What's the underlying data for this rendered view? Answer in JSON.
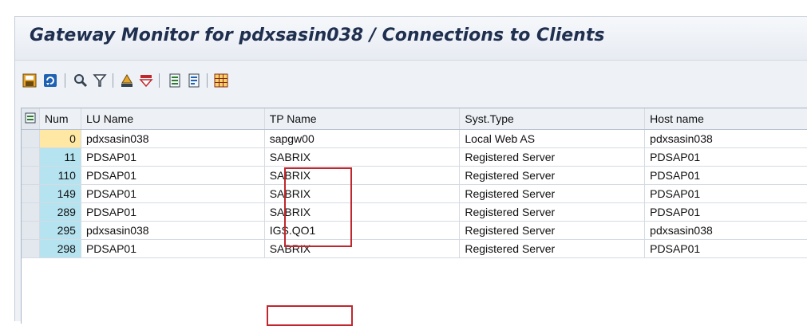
{
  "title": "Gateway Monitor for pdxsasin038 / Connections to Clients",
  "toolbar": {
    "buttons": [
      {
        "name": "save-icon"
      },
      {
        "name": "refresh-icon"
      },
      {
        "name": "find-icon"
      },
      {
        "name": "filter-icon"
      },
      {
        "name": "print-icon"
      },
      {
        "name": "sort-icon"
      },
      {
        "name": "export-icon"
      },
      {
        "name": "layout-icon"
      },
      {
        "name": "grid-icon"
      }
    ]
  },
  "table": {
    "columns": [
      "Num",
      "LU Name",
      "TP Name",
      "Syst.Type",
      "Host name"
    ],
    "rows": [
      [
        "0",
        "pdxsasin038",
        "sapgw00",
        "Local Web AS",
        "pdxsasin038"
      ],
      [
        "11",
        "PDSAP01",
        "SABRIX",
        "Registered Server",
        "PDSAP01"
      ],
      [
        "110",
        "PDSAP01",
        "SABRIX",
        "Registered Server",
        "PDSAP01"
      ],
      [
        "149",
        "PDSAP01",
        "SABRIX",
        "Registered Server",
        "PDSAP01"
      ],
      [
        "289",
        "PDSAP01",
        "SABRIX",
        "Registered Server",
        "PDSAP01"
      ],
      [
        "295",
        "pdxsasin038",
        "IGS.QO1",
        "Registered Server",
        "pdxsasin038"
      ],
      [
        "298",
        "PDSAP01",
        "SABRIX",
        "Registered Server",
        "PDSAP01"
      ]
    ]
  },
  "colors": {
    "highlight_box": "#c0272d",
    "num_cell": "#b6e3f0",
    "num_cell_first": "#ffe8a3"
  }
}
